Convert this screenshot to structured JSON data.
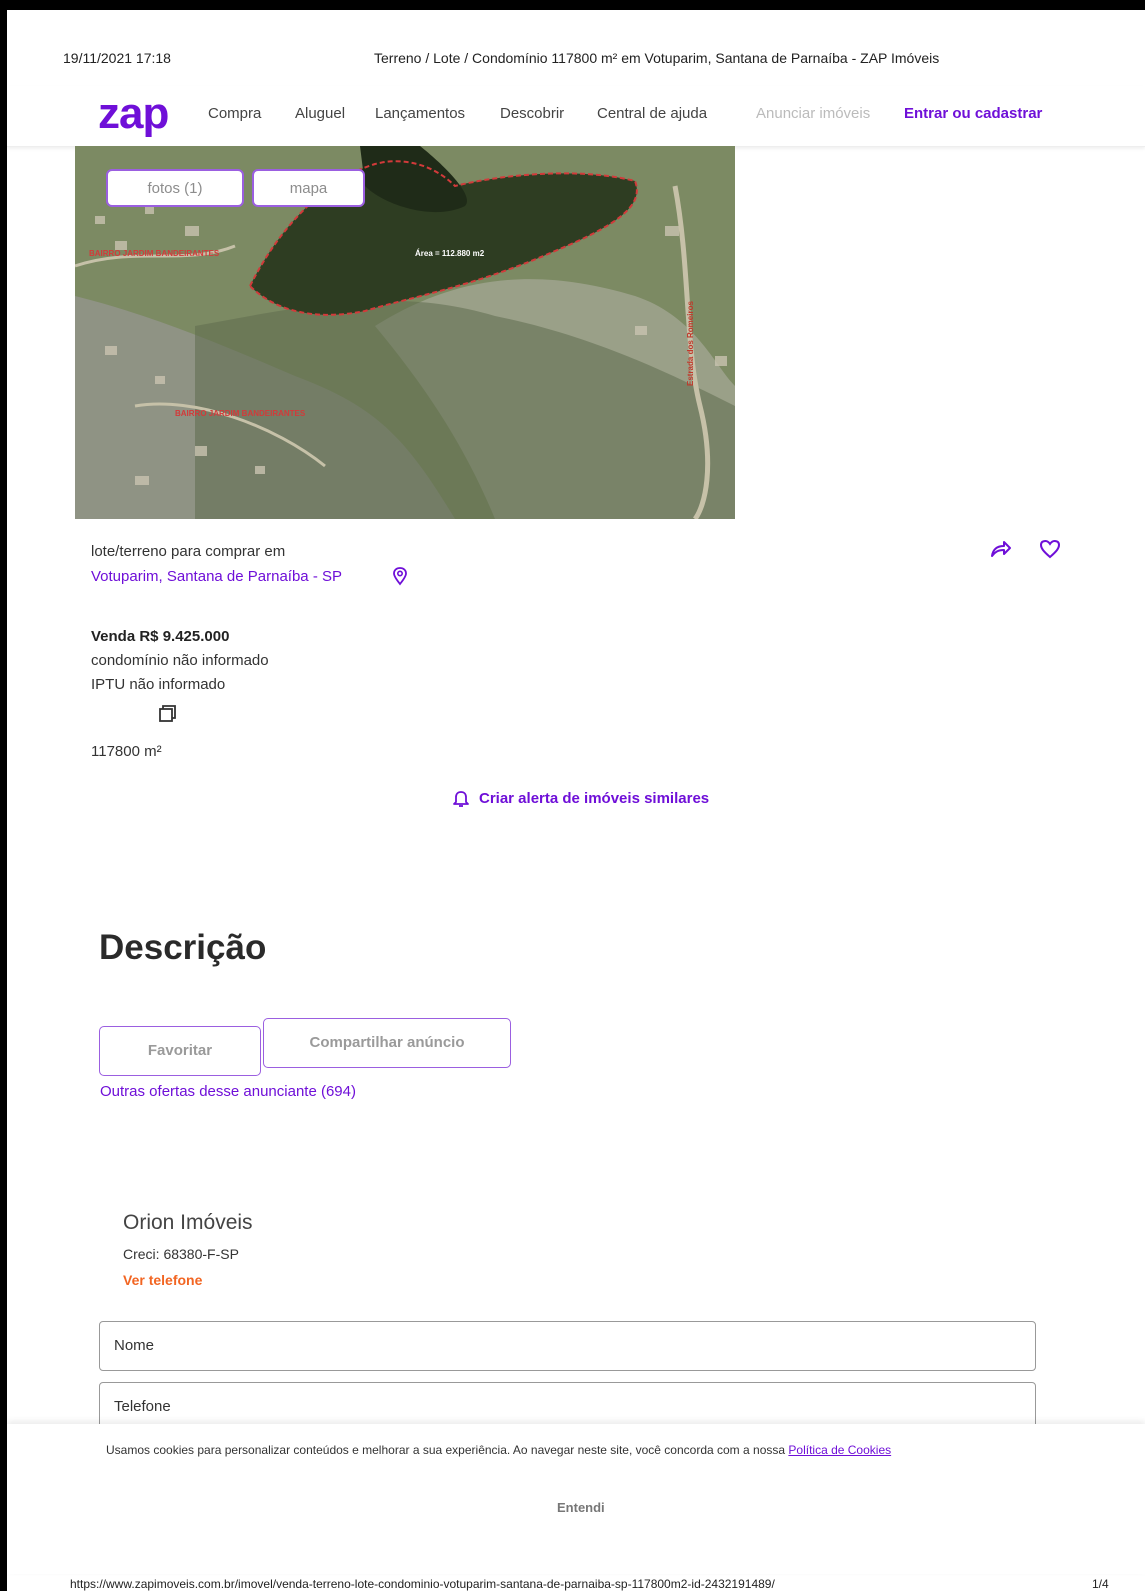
{
  "print": {
    "date": "19/11/2021 17:18",
    "title": "Terreno / Lote / Condomínio 117800 m² em Votuparim, Santana de Parnaíba - ZAP Imóveis",
    "url": "https://www.zapimoveis.com.br/imovel/venda-terreno-lote-condominio-votuparim-santana-de-parnaiba-sp-117800m2-id-2432191489/",
    "page": "1/4"
  },
  "nav": {
    "logo": "zap",
    "links": [
      "Compra",
      "Aluguel",
      "Lançamentos",
      "Descobrir",
      "Central de ajuda"
    ],
    "announce": "Anunciar imóveis",
    "login": "Entrar ou cadastrar"
  },
  "photo": {
    "photos_button": "fotos (1)",
    "map_button": "mapa",
    "labels": {
      "bairro_top": "BAIRRO JARDIM BANDEIRANTES",
      "area": "Área = 112.880 m2",
      "bairro_bottom": "BAIRRO JARDIM BANDEIRANTES",
      "road": "Estrada dos Romeiros"
    }
  },
  "listing": {
    "type_label": "lote/terreno para comprar em",
    "location": "Votuparim, Santana de Parnaíba - SP",
    "price": "Venda R$ 9.425.000",
    "condo": "condomínio não informado",
    "iptu": "IPTU não informado",
    "area": "117800 m²",
    "alert": "Criar alerta de imóveis similares"
  },
  "description": {
    "title": "Descrição",
    "favorite": "Favoritar",
    "share": "Compartilhar anúncio",
    "more_offers": "Outras ofertas desse anunciante (694)"
  },
  "advertiser": {
    "name": "Orion Imóveis",
    "creci": "Creci: 68380-F-SP",
    "phone": "Ver telefone"
  },
  "form": {
    "name_placeholder": "Nome",
    "phone_placeholder": "Telefone"
  },
  "cookie": {
    "text": "Usamos cookies para personalizar conteúdos e melhorar a sua experiência. Ao navegar neste site, você concorda com a nossa ",
    "link": "Política de Cookies",
    "ok": "Entendi"
  },
  "colors": {
    "brand": "#6f0fd8",
    "phone_link": "#f26522"
  }
}
